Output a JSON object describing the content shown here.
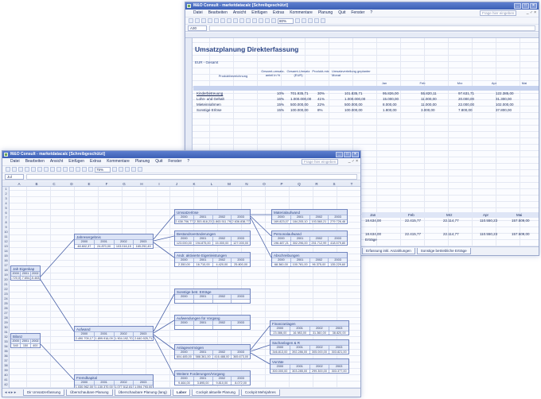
{
  "back_window": {
    "title": "M&O Consult - marketdatacalc [Schreibgeschützt]",
    "menu": [
      "Datei",
      "Bearbeiten",
      "Ansicht",
      "Einfügen",
      "Extras",
      "Kommentare",
      "Planung",
      "Quit",
      "Fenster",
      "?"
    ],
    "help_placeholder": "Frage hier eingeben",
    "window_controls": "_ ♂ ×",
    "zoom": "80%",
    "name_box": "A30",
    "sheet_title": "Umsatzplanung Direkterfassung",
    "unit_label": "EUR - Gesamt",
    "headers": {
      "product": "Produktbezeichnung",
      "h1": "Gesamt-umsatz-anteil in %",
      "h2": "Gesamt-Umsatz (EUR)",
      "h3": "Produkt-mix",
      "h4": "Umsatzverteilung geplanter Monat",
      "months": [
        "Jan",
        "Feb",
        "Mrz",
        "Apr",
        "Mai"
      ]
    },
    "rows": [
      {
        "name": "Kinderbetreuung",
        "share": "10%",
        "total": "701.935,71",
        "mix": "30%",
        "v": [
          "101.835,71",
          "95.826,00",
          "55.820,11",
          "97.631,71",
          "122.385,00"
        ]
      },
      {
        "name": "Lohn- und Gehalt",
        "share": "16%",
        "total": "1.000.000,00",
        "mix": "41%",
        "v": [
          "1.000.000,00",
          "15.000,00",
          "11.000,00",
          "20.000,00",
          "31.300,00"
        ]
      },
      {
        "name": "Mieteinnahmen",
        "share": "15%",
        "total": "500.000,00",
        "mix": "22%",
        "v": [
          "500.000,00",
          "8.000,00",
          "11.000,00",
          "22.000,00",
          "102.000,00"
        ]
      },
      {
        "name": "Sonstige Erlöse",
        "share": "15%",
        "total": "100.000,00",
        "mix": "8%",
        "v": [
          "100.000,00",
          "1.800,00",
          "3.000,00",
          "7.800,00",
          "37.800,00"
        ]
      }
    ],
    "summary_months": [
      "Jan",
      "Feb",
      "Mrz",
      "Apr",
      "Mai"
    ],
    "summary_values": [
      "18.634,00",
      "22.415,77",
      "22.114,77",
      "110.550,23",
      "157.509,00"
    ],
    "summary_label": "Erträge",
    "tabs": [
      "Erfassung inkl. Anzahlungen",
      "Sonstige betriebliche Erträge"
    ]
  },
  "front_window": {
    "title": "M&O Consult - marketdatacalc [Schreibgeschützt]",
    "menu": [
      "Datei",
      "Bearbeiten",
      "Ansicht",
      "Einfügen",
      "Extras",
      "Kommentare",
      "Planung",
      "Quit",
      "Fenster",
      "?"
    ],
    "help_placeholder": "Frage hier eingeben",
    "window_controls": "_ ♂ ×",
    "zoom": "75%",
    "name_box": "Jul",
    "column_letters": [
      "A",
      "B",
      "C",
      "D",
      "E",
      "F",
      "G",
      "H",
      "I",
      "J",
      "K",
      "L",
      "M",
      "N",
      "O",
      "P",
      "Q",
      "R",
      "S",
      "T"
    ],
    "row_numbers": [
      "1",
      "2",
      "3",
      "4",
      "5",
      "6",
      "7",
      "8",
      "9",
      "10",
      "11",
      "12",
      "13",
      "14",
      "15",
      "16",
      "17",
      "18",
      "19",
      "20",
      "21",
      "22",
      "23",
      "24",
      "25",
      "26",
      "27",
      "28",
      "29",
      "30",
      "31",
      "32",
      "33",
      "34",
      "35",
      "36",
      "37",
      "38",
      "39",
      "40",
      "41",
      "42",
      "43"
    ],
    "boxes": {
      "eigenkapital": {
        "title": "Jah Eigenkap",
        "years": [
          "2000",
          "2001",
          "2002"
        ],
        "values": [
          "-720,0",
          "-7.654,5",
          "-5.463,2"
        ]
      },
      "jahresergebnis": {
        "title": "Jahresergebnis",
        "years": [
          "2000",
          "2001",
          "2002",
          "2003"
        ],
        "values": [
          "48.602,37",
          "24.870,00",
          "103.016,15",
          "165.292,49"
        ]
      },
      "umsatzerloese": {
        "title": "Umsatzerlöse",
        "years": [
          "2000",
          "2001",
          "2002",
          "2003"
        ],
        "values": [
          "2.438.706,77",
          "2.353.818,23",
          "1.863.511,79",
          "2.636.838,77"
        ]
      },
      "bestandsveraenderungen": {
        "title": "Bestandsveränderungen",
        "years": [
          "2000",
          "2001",
          "2002",
          "2003"
        ],
        "values": [
          "123.000,00",
          "194.875,00",
          "15.000,00",
          "127.000,00"
        ]
      },
      "eigenleistungen": {
        "title": "Andr. aktivierte Eigenleistungen",
        "years": [
          "2000",
          "2001",
          "2002",
          "2003"
        ],
        "values": [
          "2.350,00",
          "16.710,00",
          "4.420,00",
          "25.800,00"
        ]
      },
      "materialaufwand": {
        "title": "Materialaufwand",
        "years": [
          "2000",
          "2001",
          "2002",
          "2003"
        ],
        "values": [
          "169.823,07",
          "184.205,10",
          "193.560,21",
          "279.726,46"
        ]
      },
      "personalaufwand": {
        "title": "Personalaufwand",
        "years": [
          "2000",
          "2001",
          "2002",
          "2003"
        ],
        "values": [
          "196.487,21",
          "302.296,00",
          "251.712,99",
          "418.579,80"
        ]
      },
      "abschreibungen": {
        "title": "Abschreibungen",
        "years": [
          "2000",
          "2001",
          "2002",
          "2003"
        ],
        "values": [
          "68.360,00",
          "100.781,00",
          "96.375,00",
          "135.229,60"
        ]
      },
      "sonstige_ertraege": {
        "title": "Sonstige betr. Erträge",
        "years": [
          "2000",
          "2001",
          "2002",
          "2003"
        ],
        "values": [
          "",
          "",
          "",
          ""
        ]
      },
      "auflagen": {
        "title": "Aufwendungen für Vorgang",
        "years": [
          "2000",
          "2001",
          "2002",
          "2003"
        ],
        "values": [
          "",
          "",
          "",
          ""
        ]
      },
      "anlagevermoegen": {
        "title": "Anlagevermögen",
        "years": [
          "2000",
          "2001",
          "2002",
          "2003"
        ],
        "values": [
          "604.485,00",
          "588.361,00",
          "416.488,00",
          "365.673,00"
        ]
      },
      "aufwand": {
        "title": "Aufwand",
        "years": [
          "2000",
          "2001",
          "2002",
          "2003"
        ],
        "values": [
          "2.490.709,17",
          "1.899.916,09",
          "1.904.192,70",
          "2.640.925,71"
        ]
      },
      "fremdkapital": {
        "title": "Fremdkapital",
        "years": [
          "2000",
          "2001",
          "2002",
          "2003"
        ],
        "values": [
          "1.030.962,00",
          "1.130.370,00",
          "1.077.512,81",
          "1.094.793,00"
        ]
      },
      "gesamt_bilanz": {
        "title": "Bilanz",
        "years": [
          "2000",
          "2001",
          "2002"
        ],
        "values": [
          "540",
          "150",
          "400"
        ]
      },
      "finanzanlagen": {
        "title": "Finanzanlagen",
        "years": [
          "2000",
          "2001",
          "2002",
          "2003"
        ],
        "values": [
          "23.086,00",
          "16.983,00",
          "31.360,00",
          "38.820,00"
        ]
      },
      "sachanlagen": {
        "title": "Sachanlagen & R",
        "years": [
          "2000",
          "2001",
          "2002",
          "2003"
        ],
        "values": [
          "346.813,00",
          "392.286,00",
          "305.000,00",
          "303.821,00"
        ]
      },
      "vorraete": {
        "title": "Vorräte",
        "years": [
          "2000",
          "2001",
          "2002",
          "2003"
        ],
        "values": [
          "300.000,00",
          "303.285,00",
          "299.300,00",
          "303.377,00"
        ]
      },
      "forderungen": {
        "title": "Weitere Forderungen/Vorgang",
        "years": [
          "2000",
          "2001",
          "2002",
          "2003"
        ],
        "values": [
          "9.464,00",
          "3.895,00",
          "9.810,00",
          "8.072,00"
        ]
      }
    },
    "tabs": [
      "Dir Umsatzerfassung",
      "Überschaubare Planung",
      "Überschaubare Planung (lang)",
      "Labor",
      "Cockpit aktuelle Planung",
      "Cockpit Mehrjahres"
    ],
    "active_tab": "Labor"
  }
}
